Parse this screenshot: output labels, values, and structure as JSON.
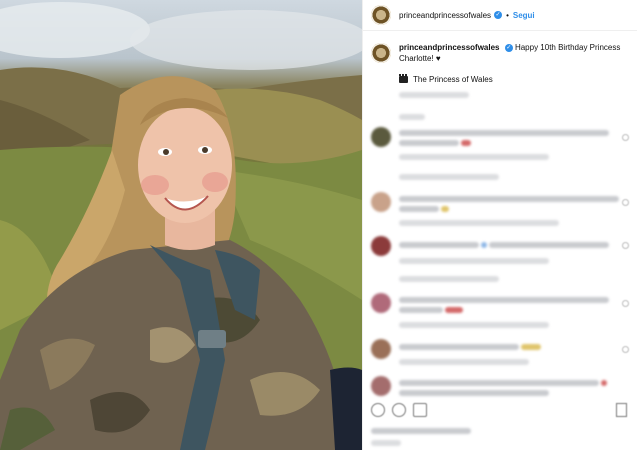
{
  "header": {
    "username": "princeandprincessofwales",
    "verified_icon": "verified-badge-icon",
    "separator": "•",
    "follow_label": "Segui"
  },
  "post": {
    "caption_user": "princeandprincessofwales",
    "caption_text": "Happy 10th Birthday Princess Charlotte!",
    "caption_emoji": "♥",
    "credit_icon": "clapperboard-icon",
    "credit_text": "The Princess of Wales"
  },
  "comments_icons": [
    "avatar",
    "like-heart-icon"
  ],
  "actions": [
    "like-icon",
    "comment-icon",
    "share-icon",
    "bookmark-icon"
  ]
}
